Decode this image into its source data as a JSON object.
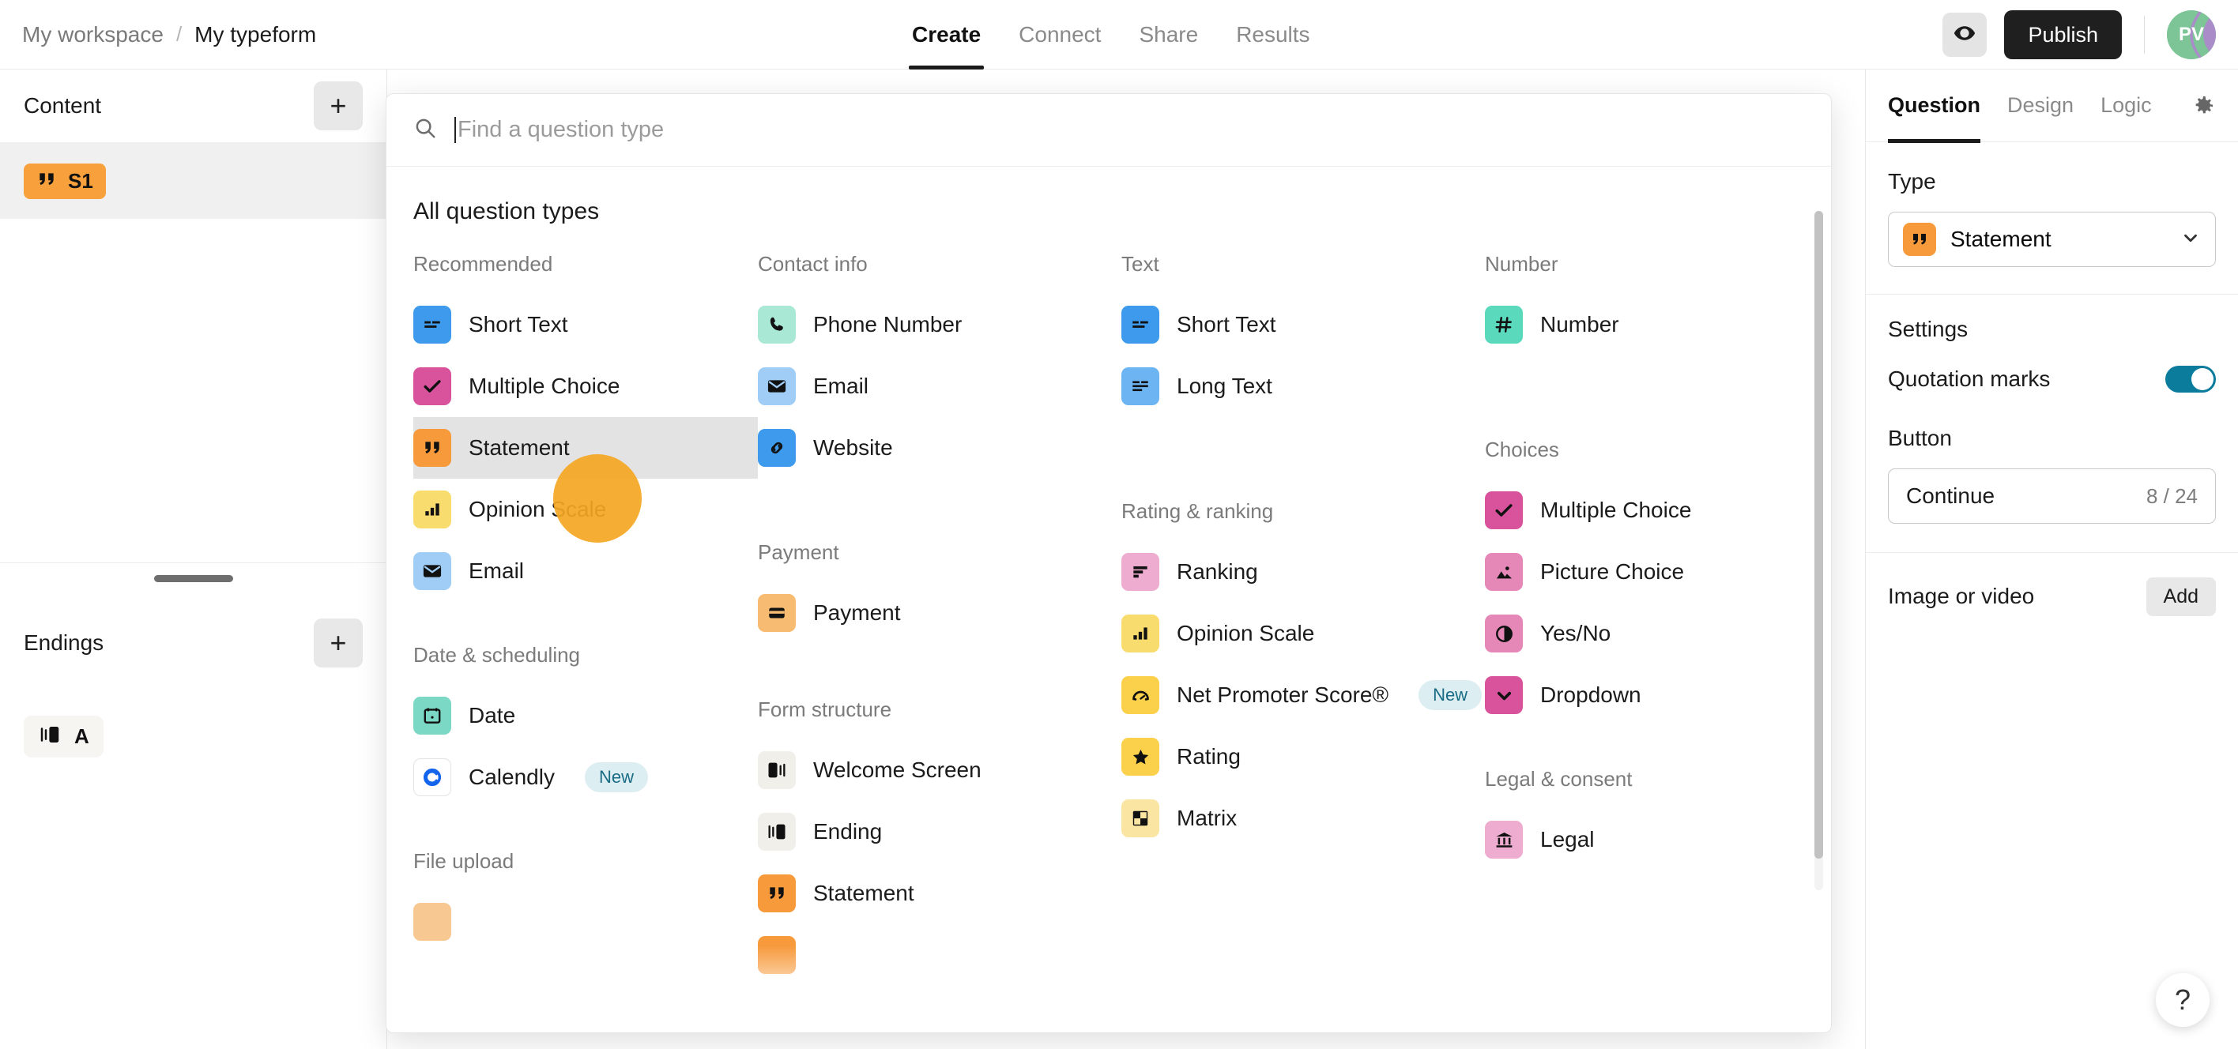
{
  "topbar": {
    "workspace": "My workspace",
    "separator": "/",
    "form_title": "My typeform",
    "tabs": [
      {
        "label": "Create",
        "active": true
      },
      {
        "label": "Connect",
        "active": false
      },
      {
        "label": "Share",
        "active": false
      },
      {
        "label": "Results",
        "active": false
      }
    ],
    "preview_icon": "eye-icon",
    "publish_label": "Publish",
    "avatar_initials": "PV"
  },
  "sidebar": {
    "content_title": "Content",
    "add_content_label": "+",
    "items": [
      {
        "badge": "S1",
        "icon": "quote-icon",
        "color": "#f8a03c"
      }
    ],
    "endings_title": "Endings",
    "add_ending_label": "+",
    "endings": [
      {
        "badge": "A",
        "icon": "ending-screen-icon"
      }
    ]
  },
  "question_picker": {
    "search_placeholder": "Find a question type",
    "search_value": "",
    "heading": "All question types",
    "columns": [
      {
        "groups": [
          {
            "label": "Recommended",
            "items": [
              {
                "label": "Short Text",
                "icon": "short-text-icon",
                "color": "#3d9aed",
                "highlighted": false
              },
              {
                "label": "Multiple Choice",
                "icon": "check-icon",
                "color": "#d8539c",
                "highlighted": false
              },
              {
                "label": "Statement",
                "icon": "quote-icon",
                "color": "#f79a3c",
                "highlighted": true
              },
              {
                "label": "Opinion Scale",
                "icon": "bar-chart-icon",
                "color": "#f9dc6e",
                "highlighted": false
              },
              {
                "label": "Email",
                "icon": "envelope-icon",
                "color": "#9fcdf6",
                "highlighted": false
              }
            ]
          },
          {
            "label": "Date & scheduling",
            "items": [
              {
                "label": "Date",
                "icon": "calendar-icon",
                "color": "#7ad8c4",
                "highlighted": false
              },
              {
                "label": "Calendly",
                "icon": "calendly-icon",
                "color": "#ffffff",
                "badge": "New",
                "highlighted": false
              }
            ]
          },
          {
            "label": "File upload",
            "items": []
          }
        ]
      },
      {
        "groups": [
          {
            "label": "Contact info",
            "items": [
              {
                "label": "Phone Number",
                "icon": "phone-icon",
                "color": "#a9e8d5",
                "highlighted": false
              },
              {
                "label": "Email",
                "icon": "envelope-icon",
                "color": "#9fcdf6",
                "highlighted": false
              },
              {
                "label": "Website",
                "icon": "link-icon",
                "color": "#3d9aed",
                "highlighted": false
              }
            ]
          },
          {
            "label": "Payment",
            "items": [
              {
                "label": "Payment",
                "icon": "credit-card-icon",
                "color": "#f7bb72",
                "highlighted": false
              }
            ]
          },
          {
            "label": "Form structure",
            "items": [
              {
                "label": "Welcome Screen",
                "icon": "welcome-screen-icon",
                "color": "#f1efe9",
                "highlighted": false
              },
              {
                "label": "Ending",
                "icon": "ending-screen-icon",
                "color": "#f1efe9",
                "highlighted": false
              },
              {
                "label": "Statement",
                "icon": "quote-icon",
                "color": "#f79a3c",
                "highlighted": false
              }
            ]
          }
        ]
      },
      {
        "groups": [
          {
            "label": "Text",
            "items": [
              {
                "label": "Short Text",
                "icon": "short-text-icon",
                "color": "#3d9aed",
                "highlighted": false
              },
              {
                "label": "Long Text",
                "icon": "long-text-icon",
                "color": "#6cb4f2",
                "highlighted": false
              }
            ]
          },
          {
            "label": "Rating & ranking",
            "items": [
              {
                "label": "Ranking",
                "icon": "ranking-icon",
                "color": "#eeacd0",
                "highlighted": false
              },
              {
                "label": "Opinion Scale",
                "icon": "bar-chart-icon",
                "color": "#f9dc6e",
                "highlighted": false
              },
              {
                "label": "Net Promoter Score®",
                "icon": "gauge-icon",
                "color": "#fbd14b",
                "badge": "New",
                "highlighted": false
              },
              {
                "label": "Rating",
                "icon": "star-icon",
                "color": "#fbd14b",
                "highlighted": false
              },
              {
                "label": "Matrix",
                "icon": "matrix-icon",
                "color": "#fae5a3",
                "highlighted": false
              }
            ]
          }
        ]
      },
      {
        "groups": [
          {
            "label": "Number",
            "items": [
              {
                "label": "Number",
                "icon": "hash-icon",
                "color": "#5ad9bd",
                "highlighted": false
              }
            ]
          },
          {
            "label": "Choices",
            "items": [
              {
                "label": "Multiple Choice",
                "icon": "check-icon",
                "color": "#d8539c",
                "highlighted": false
              },
              {
                "label": "Picture Choice",
                "icon": "image-icon",
                "color": "#e588b8",
                "highlighted": false
              },
              {
                "label": "Yes/No",
                "icon": "half-circle-icon",
                "color": "#e588b8",
                "highlighted": false
              },
              {
                "label": "Dropdown",
                "icon": "chevron-down-icon",
                "color": "#d8539c",
                "highlighted": false
              }
            ]
          },
          {
            "label": "Legal & consent",
            "items": [
              {
                "label": "Legal",
                "icon": "bank-icon",
                "color": "#eeacd0",
                "highlighted": false
              }
            ]
          }
        ]
      }
    ]
  },
  "right_panel": {
    "tabs": [
      {
        "label": "Question",
        "active": true
      },
      {
        "label": "Design",
        "active": false
      },
      {
        "label": "Logic",
        "active": false
      }
    ],
    "settings_icon": "gear-icon",
    "type_label": "Type",
    "type_value": "Statement",
    "type_icon": "quote-icon",
    "type_color": "#f79a3c",
    "settings_label": "Settings",
    "quotation_marks_label": "Quotation marks",
    "quotation_marks_on": true,
    "toggle_color": "#0b7c9c",
    "button_label": "Button",
    "button_value": "Continue",
    "button_counter": "8 / 24",
    "image_or_video_label": "Image or video",
    "add_label": "Add"
  },
  "help": {
    "icon": "question-mark-icon",
    "label": "?"
  }
}
